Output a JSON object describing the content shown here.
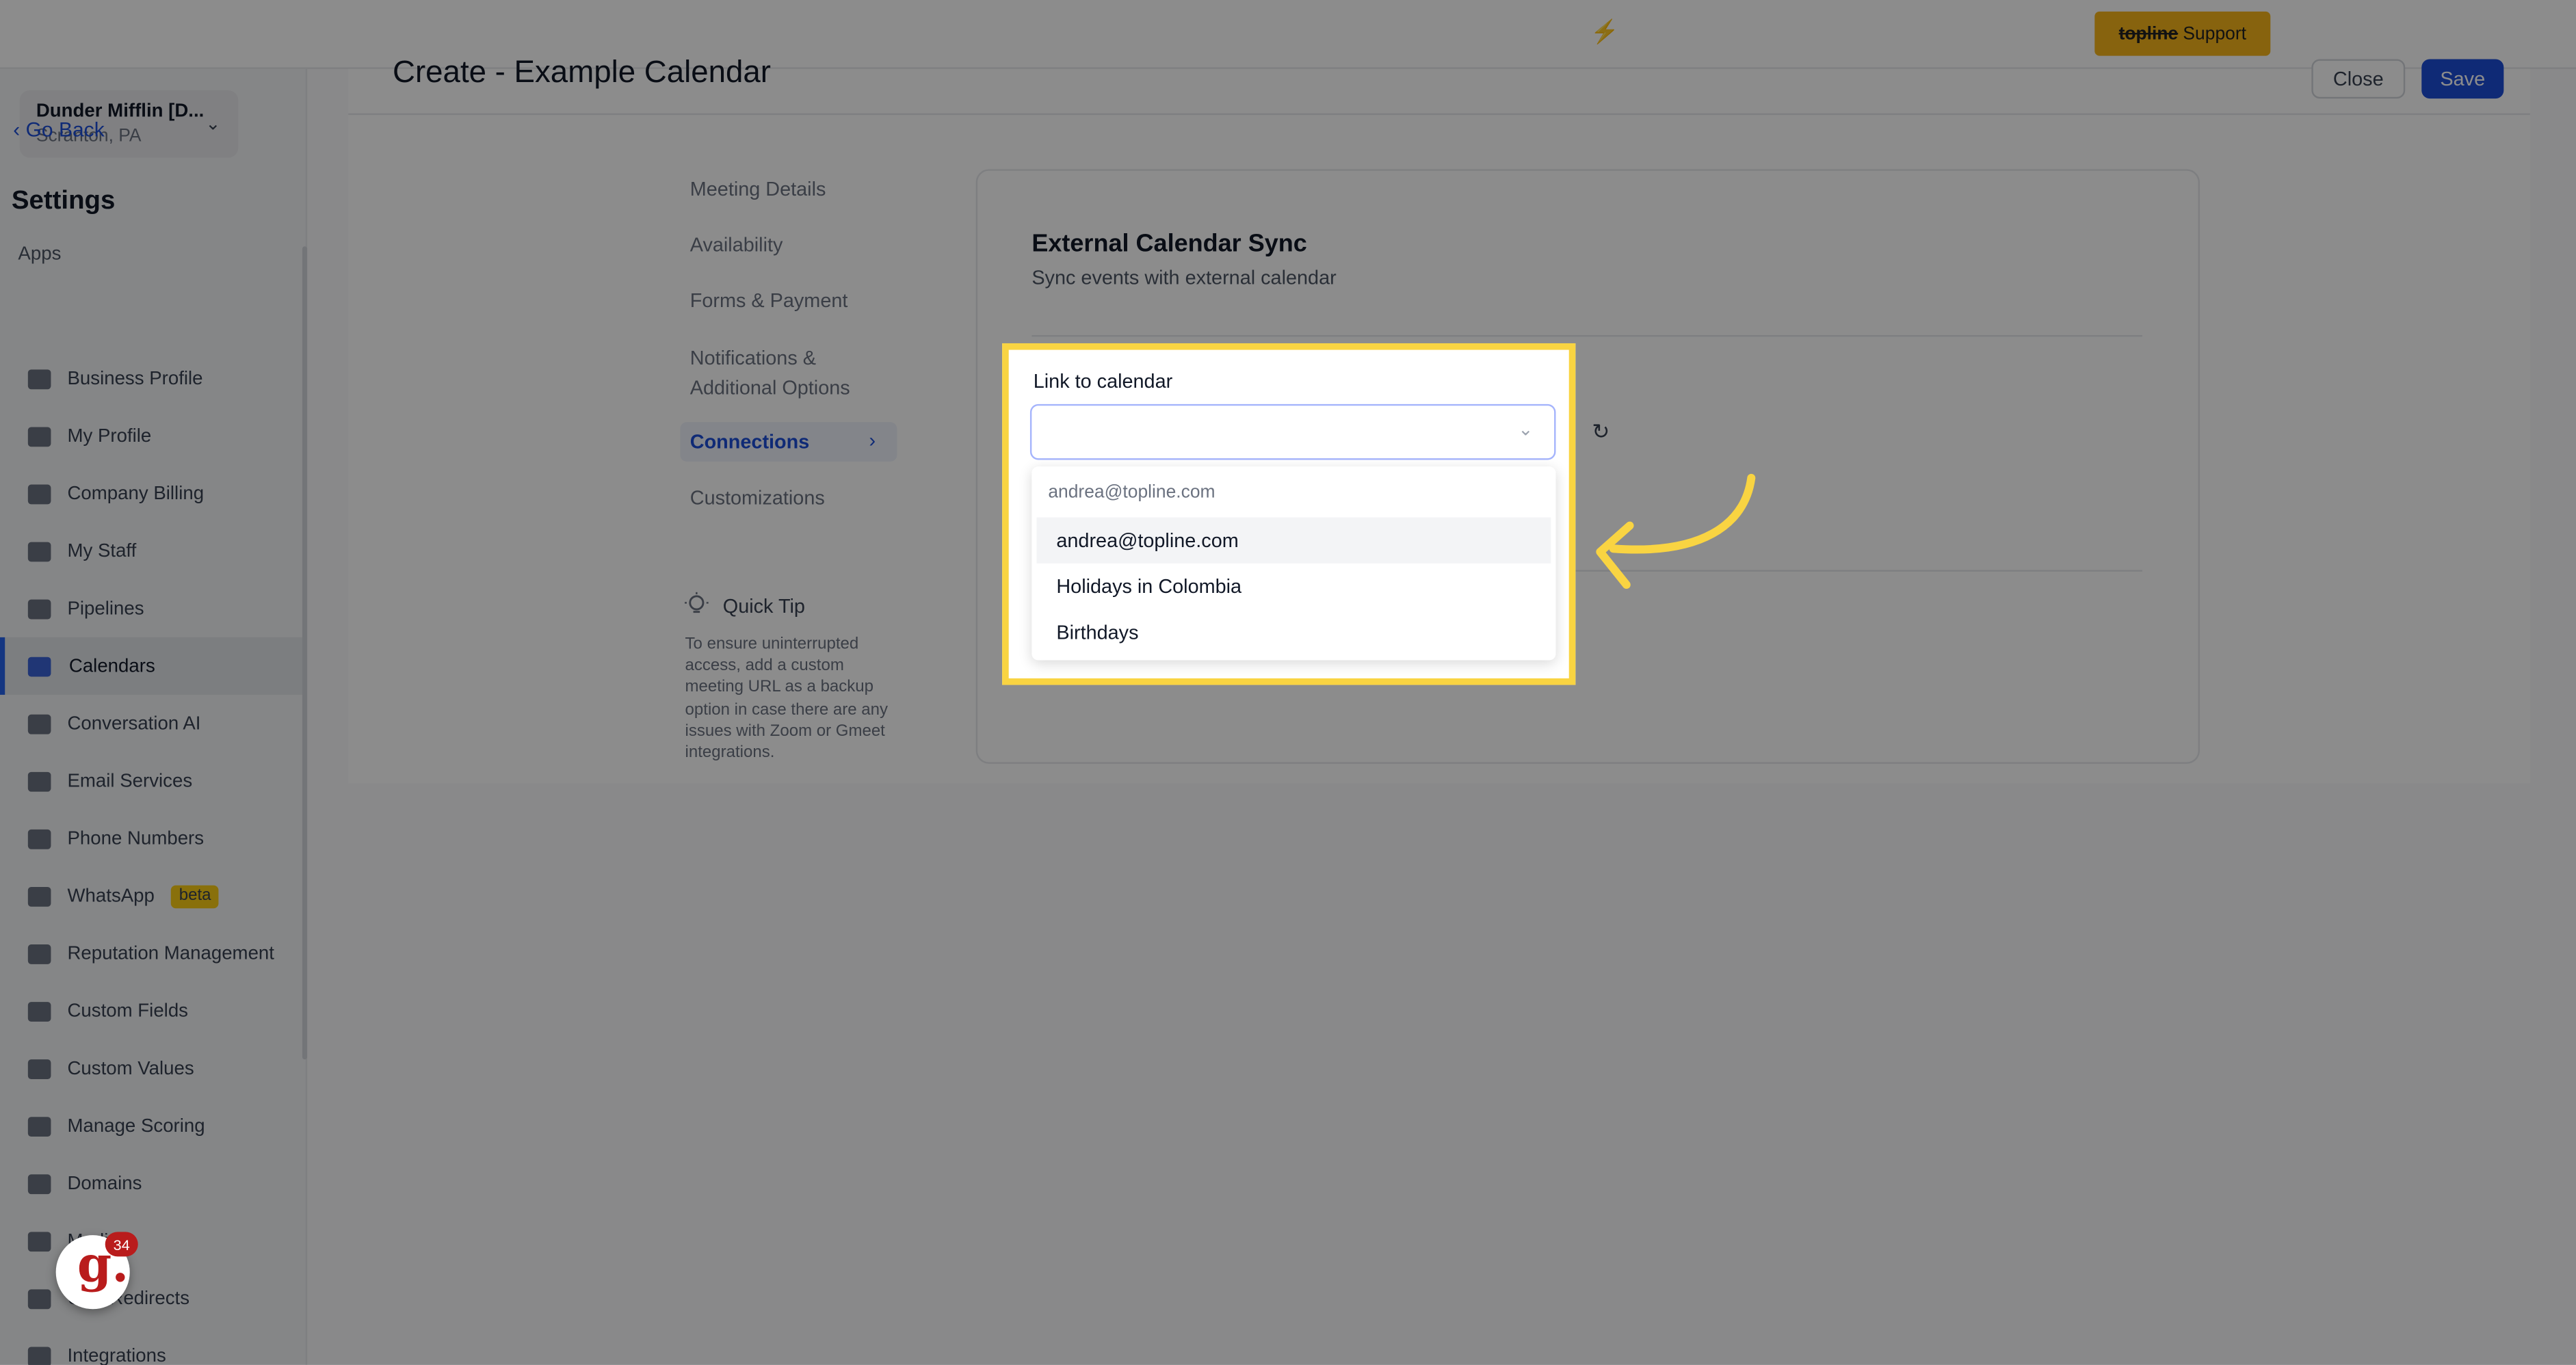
{
  "topbar": {
    "bolt_icon": "lightning-icon",
    "support": {
      "brand": "topline",
      "label": "Support"
    }
  },
  "sidebar": {
    "location": {
      "name": "Dunder Mifflin [D...",
      "sub": "Scranton, PA"
    },
    "go_back": "Go Back",
    "title": "Settings",
    "section_label": "Apps",
    "items": [
      {
        "label": "Business Profile",
        "icon": "briefcase-icon"
      },
      {
        "label": "My Profile",
        "icon": "user-icon"
      },
      {
        "label": "Company Billing",
        "icon": "grid-icon"
      },
      {
        "label": "My Staff",
        "icon": "staff-icon"
      },
      {
        "label": "Pipelines",
        "icon": "filter-icon"
      },
      {
        "label": "Calendars",
        "icon": "calendar-icon",
        "active": true
      },
      {
        "label": "Conversation AI",
        "icon": "chat-icon"
      },
      {
        "label": "Email Services",
        "icon": "mail-icon"
      },
      {
        "label": "Phone Numbers",
        "icon": "phone-icon"
      },
      {
        "label": "WhatsApp",
        "icon": "whatsapp-icon",
        "badge": "beta"
      },
      {
        "label": "Reputation Management",
        "icon": "star-icon"
      },
      {
        "label": "Custom Fields",
        "icon": "edit-icon"
      },
      {
        "label": "Custom Values",
        "icon": "pie-icon"
      },
      {
        "label": "Manage Scoring",
        "icon": "chart-icon"
      },
      {
        "label": "Domains",
        "icon": "domain-icon"
      },
      {
        "label": "Media",
        "icon": "video-icon"
      },
      {
        "label": "URL Redirects",
        "icon": "link-icon"
      },
      {
        "label": "Integrations",
        "icon": "integration-icon"
      }
    ]
  },
  "badge": {
    "letter": "g.",
    "count": "34"
  },
  "header": {
    "title": "Create - Example Calendar",
    "close": "Close",
    "save": "Save"
  },
  "tabs": [
    {
      "label": "Meeting Details"
    },
    {
      "label": "Availability"
    },
    {
      "label": "Forms & Payment"
    },
    {
      "label": "Notifications & Additional Options"
    },
    {
      "label": "Connections",
      "active": true
    },
    {
      "label": "Customizations"
    }
  ],
  "quick_tip": {
    "title": "Quick Tip",
    "text": "To ensure uninterrupted access, add a custom meeting URL as a backup option in case there are any issues with Zoom or Gmeet integrations."
  },
  "card": {
    "title": "External Calendar Sync",
    "subtitle": "Sync events with external calendar"
  },
  "link_calendar": {
    "label": "Link to calendar",
    "value": "",
    "group_label": "andrea@topline.com",
    "options": [
      "andrea@topline.com",
      "Holidays in Colombia",
      "Birthdays"
    ],
    "hovered_index": 0
  },
  "colors": {
    "accent": "#1d4ed8",
    "highlight": "#f9d442",
    "support": "#f6b51a"
  }
}
